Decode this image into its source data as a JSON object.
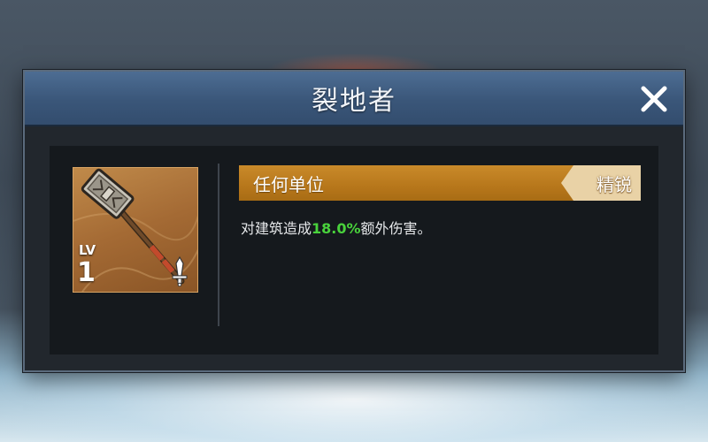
{
  "dialog": {
    "title": "裂地者",
    "close_icon": "close-icon"
  },
  "weapon": {
    "icon": "warhammer-icon",
    "level_label": "LV",
    "level": "1",
    "type_icon": "sword-icon"
  },
  "effect": {
    "target": "任何单位",
    "rank": "精锐",
    "desc_prefix": "对建筑造成",
    "desc_value": "18.0%",
    "desc_suffix": "额外伤害。"
  },
  "colors": {
    "title_bar": "#3a5679",
    "target_bar": "#b7771b",
    "rank_badge": "#e9d2a6",
    "highlight": "#49d23c"
  }
}
